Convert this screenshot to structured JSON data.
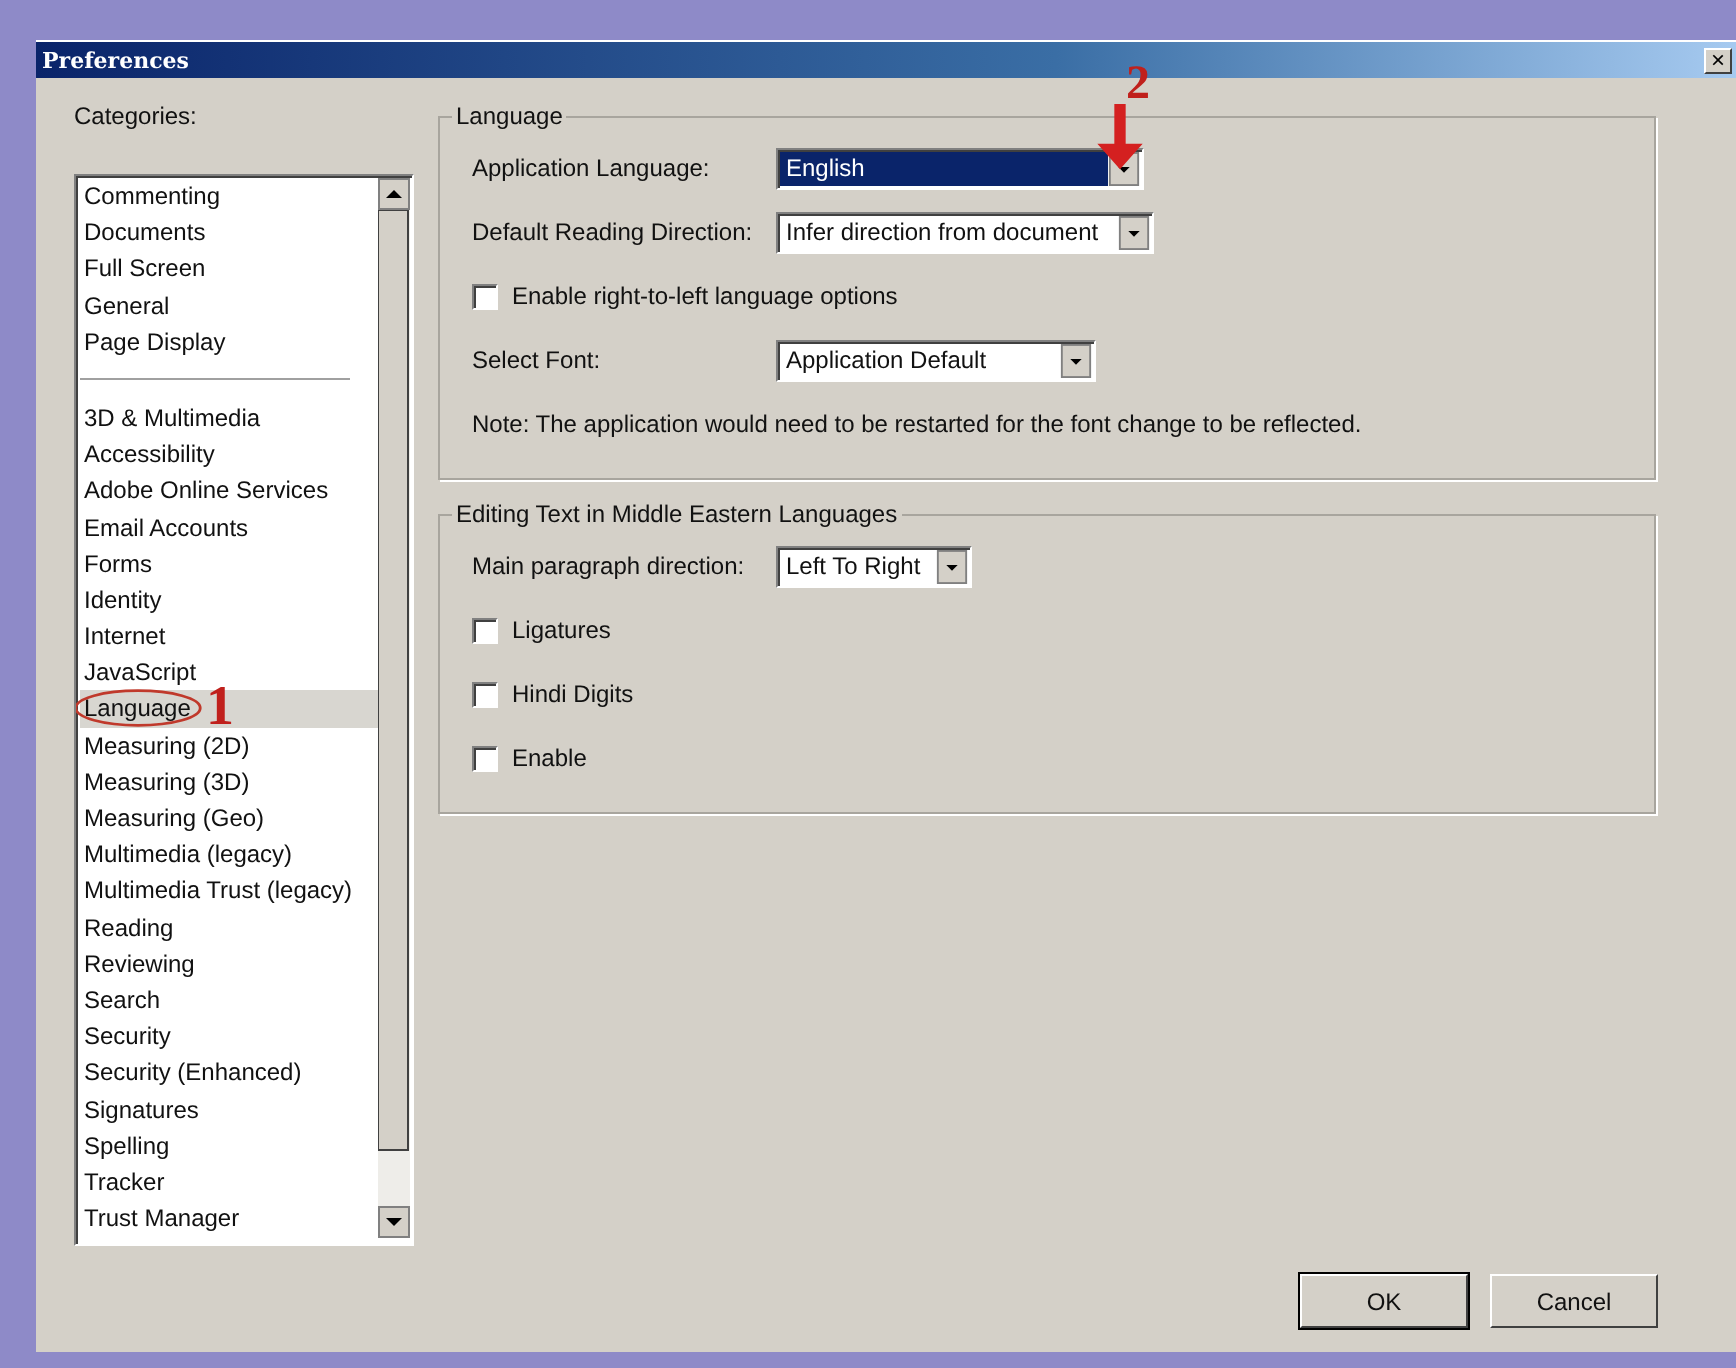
{
  "window": {
    "title": "Preferences",
    "close_label": "×"
  },
  "categories": {
    "label": "Categories:",
    "groups": [
      [
        {
          "label": "Commenting",
          "selected": false,
          "circled": false
        },
        {
          "label": "Documents",
          "selected": false,
          "circled": false
        },
        {
          "label": "Full Screen",
          "selected": false,
          "circled": false
        },
        {
          "label": "General",
          "selected": false,
          "circled": false
        },
        {
          "label": "Page Display",
          "selected": false,
          "circled": false
        }
      ],
      [
        {
          "label": "3D & Multimedia",
          "selected": false,
          "circled": false
        },
        {
          "label": "Accessibility",
          "selected": false,
          "circled": false
        },
        {
          "label": "Adobe Online Services",
          "selected": false,
          "circled": false
        },
        {
          "label": "Email Accounts",
          "selected": false,
          "circled": false
        },
        {
          "label": "Forms",
          "selected": false,
          "circled": false
        },
        {
          "label": "Identity",
          "selected": false,
          "circled": false
        },
        {
          "label": "Internet",
          "selected": false,
          "circled": false
        },
        {
          "label": "JavaScript",
          "selected": false,
          "circled": false
        },
        {
          "label": "Language",
          "selected": true,
          "circled": true
        },
        {
          "label": "Measuring (2D)",
          "selected": false,
          "circled": false
        },
        {
          "label": "Measuring (3D)",
          "selected": false,
          "circled": false
        },
        {
          "label": "Measuring (Geo)",
          "selected": false,
          "circled": false
        },
        {
          "label": "Multimedia (legacy)",
          "selected": false,
          "circled": false
        },
        {
          "label": "Multimedia Trust (legacy)",
          "selected": false,
          "circled": false
        },
        {
          "label": "Reading",
          "selected": false,
          "circled": false
        },
        {
          "label": "Reviewing",
          "selected": false,
          "circled": false
        },
        {
          "label": "Search",
          "selected": false,
          "circled": false
        },
        {
          "label": "Security",
          "selected": false,
          "circled": false
        },
        {
          "label": "Security (Enhanced)",
          "selected": false,
          "circled": false
        },
        {
          "label": "Signatures",
          "selected": false,
          "circled": false
        },
        {
          "label": "Spelling",
          "selected": false,
          "circled": false
        },
        {
          "label": "Tracker",
          "selected": false,
          "circled": false
        },
        {
          "label": "Trust Manager",
          "selected": false,
          "circled": false
        }
      ]
    ]
  },
  "groups": [
    {
      "title": "Language",
      "rows": [
        {
          "kind": "select",
          "label": "Application Language:",
          "value": "English",
          "focused": true
        },
        {
          "kind": "select",
          "label": "Default Reading Direction:",
          "value": "Infer direction from document",
          "focused": false
        },
        {
          "kind": "checkbox",
          "label": "Enable right-to-left language options",
          "checked": false
        },
        {
          "kind": "select",
          "label": "Select Font:",
          "value": "Application Default",
          "focused": false
        },
        {
          "kind": "note",
          "text": "Note: The application would need to be restarted for the font change to be reflected."
        }
      ]
    },
    {
      "title": "Editing Text in Middle Eastern Languages",
      "rows": [
        {
          "kind": "select",
          "label": "Main paragraph direction:",
          "value": "Left To Right",
          "focused": false
        },
        {
          "kind": "checkbox",
          "label": "Ligatures",
          "checked": false
        },
        {
          "kind": "checkbox",
          "label": "Hindi Digits",
          "checked": false
        },
        {
          "kind": "checkbox",
          "label": "Enable",
          "checked": false
        }
      ]
    }
  ],
  "buttons": [
    "OK",
    "Cancel"
  ],
  "annotations": [
    {
      "kind": "circle",
      "text": "1"
    },
    {
      "kind": "arrow",
      "text": "2"
    }
  ]
}
